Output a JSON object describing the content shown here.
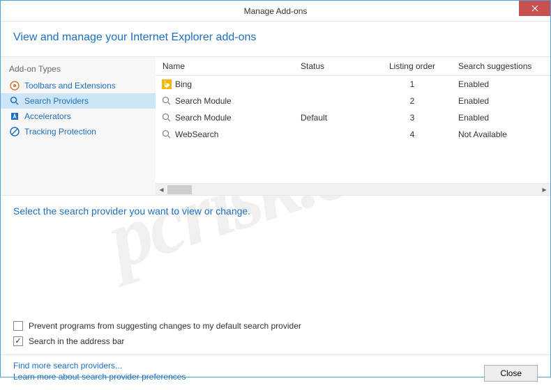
{
  "window": {
    "title": "Manage Add-ons"
  },
  "header": {
    "title": "View and manage your Internet Explorer add-ons"
  },
  "sidebar": {
    "heading": "Add-on Types",
    "items": [
      {
        "label": "Toolbars and Extensions",
        "icon": "toolbar"
      },
      {
        "label": "Search Providers",
        "icon": "search",
        "selected": true
      },
      {
        "label": "Accelerators",
        "icon": "accelerator"
      },
      {
        "label": "Tracking Protection",
        "icon": "protection"
      }
    ]
  },
  "table": {
    "columns": {
      "name": "Name",
      "status": "Status",
      "order": "Listing order",
      "suggest": "Search suggestions"
    },
    "rows": [
      {
        "name": "Bing",
        "status": "",
        "order": "1",
        "suggest": "Enabled",
        "icon": "bing"
      },
      {
        "name": "Search Module",
        "status": "",
        "order": "2",
        "suggest": "Enabled",
        "icon": "search-generic"
      },
      {
        "name": "Search Module",
        "status": "Default",
        "order": "3",
        "suggest": "Enabled",
        "icon": "search-generic"
      },
      {
        "name": "WebSearch",
        "status": "",
        "order": "4",
        "suggest": "Not Available",
        "icon": "search-generic"
      }
    ]
  },
  "details": {
    "title": "Select the search provider you want to view or change."
  },
  "options": {
    "prevent_changes": {
      "label": "Prevent programs from suggesting changes to my default search provider",
      "checked": false
    },
    "search_addressbar": {
      "label": "Search in the address bar",
      "checked": true
    }
  },
  "footer": {
    "find_more": "Find more search providers...",
    "learn_more": "Learn more about search provider preferences",
    "close": "Close"
  },
  "watermark": "pcrisk.com"
}
